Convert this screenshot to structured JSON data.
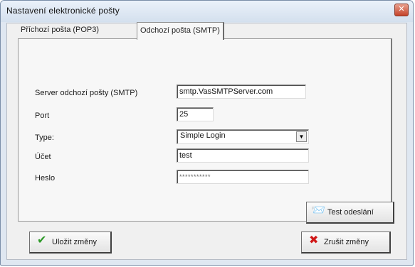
{
  "window": {
    "title": "Nastavení elektronické pošty",
    "close_label": "✕"
  },
  "tabs": [
    {
      "label": "Příchozí pošta (POP3)"
    },
    {
      "label": "Odchozí pošta (SMTP)"
    }
  ],
  "form": {
    "server_label": "Server odchozí pošty (SMTP)",
    "server_value": "smtp.VasSMTPServer.com",
    "port_label": "Port",
    "port_value": "25",
    "type_label": "Type:",
    "type_value": "Simple Login",
    "account_label": "Účet",
    "account_value": "test",
    "password_label": "Heslo",
    "password_value": "***********"
  },
  "buttons": {
    "test_send": "Test odeslání",
    "save": "Uložit změny",
    "cancel": "Zrušit změny"
  },
  "colors": {
    "check": "#2f9a2a",
    "cross": "#d01818",
    "accent": "#c4432a"
  },
  "icons": {
    "combo_arrow": "▼",
    "check": "✔",
    "cross": "✖",
    "test_send": "📨"
  }
}
